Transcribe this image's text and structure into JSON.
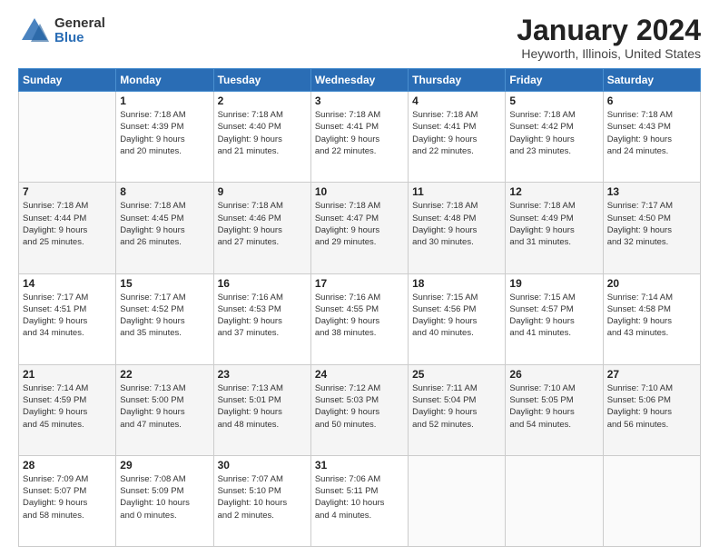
{
  "logo": {
    "general": "General",
    "blue": "Blue"
  },
  "header": {
    "title": "January 2024",
    "subtitle": "Heyworth, Illinois, United States"
  },
  "days_of_week": [
    "Sunday",
    "Monday",
    "Tuesday",
    "Wednesday",
    "Thursday",
    "Friday",
    "Saturday"
  ],
  "weeks": [
    [
      {
        "day": "",
        "info": ""
      },
      {
        "day": "1",
        "info": "Sunrise: 7:18 AM\nSunset: 4:39 PM\nDaylight: 9 hours\nand 20 minutes."
      },
      {
        "day": "2",
        "info": "Sunrise: 7:18 AM\nSunset: 4:40 PM\nDaylight: 9 hours\nand 21 minutes."
      },
      {
        "day": "3",
        "info": "Sunrise: 7:18 AM\nSunset: 4:41 PM\nDaylight: 9 hours\nand 22 minutes."
      },
      {
        "day": "4",
        "info": "Sunrise: 7:18 AM\nSunset: 4:41 PM\nDaylight: 9 hours\nand 22 minutes."
      },
      {
        "day": "5",
        "info": "Sunrise: 7:18 AM\nSunset: 4:42 PM\nDaylight: 9 hours\nand 23 minutes."
      },
      {
        "day": "6",
        "info": "Sunrise: 7:18 AM\nSunset: 4:43 PM\nDaylight: 9 hours\nand 24 minutes."
      }
    ],
    [
      {
        "day": "7",
        "info": "Sunrise: 7:18 AM\nSunset: 4:44 PM\nDaylight: 9 hours\nand 25 minutes."
      },
      {
        "day": "8",
        "info": "Sunrise: 7:18 AM\nSunset: 4:45 PM\nDaylight: 9 hours\nand 26 minutes."
      },
      {
        "day": "9",
        "info": "Sunrise: 7:18 AM\nSunset: 4:46 PM\nDaylight: 9 hours\nand 27 minutes."
      },
      {
        "day": "10",
        "info": "Sunrise: 7:18 AM\nSunset: 4:47 PM\nDaylight: 9 hours\nand 29 minutes."
      },
      {
        "day": "11",
        "info": "Sunrise: 7:18 AM\nSunset: 4:48 PM\nDaylight: 9 hours\nand 30 minutes."
      },
      {
        "day": "12",
        "info": "Sunrise: 7:18 AM\nSunset: 4:49 PM\nDaylight: 9 hours\nand 31 minutes."
      },
      {
        "day": "13",
        "info": "Sunrise: 7:17 AM\nSunset: 4:50 PM\nDaylight: 9 hours\nand 32 minutes."
      }
    ],
    [
      {
        "day": "14",
        "info": "Sunrise: 7:17 AM\nSunset: 4:51 PM\nDaylight: 9 hours\nand 34 minutes."
      },
      {
        "day": "15",
        "info": "Sunrise: 7:17 AM\nSunset: 4:52 PM\nDaylight: 9 hours\nand 35 minutes."
      },
      {
        "day": "16",
        "info": "Sunrise: 7:16 AM\nSunset: 4:53 PM\nDaylight: 9 hours\nand 37 minutes."
      },
      {
        "day": "17",
        "info": "Sunrise: 7:16 AM\nSunset: 4:55 PM\nDaylight: 9 hours\nand 38 minutes."
      },
      {
        "day": "18",
        "info": "Sunrise: 7:15 AM\nSunset: 4:56 PM\nDaylight: 9 hours\nand 40 minutes."
      },
      {
        "day": "19",
        "info": "Sunrise: 7:15 AM\nSunset: 4:57 PM\nDaylight: 9 hours\nand 41 minutes."
      },
      {
        "day": "20",
        "info": "Sunrise: 7:14 AM\nSunset: 4:58 PM\nDaylight: 9 hours\nand 43 minutes."
      }
    ],
    [
      {
        "day": "21",
        "info": "Sunrise: 7:14 AM\nSunset: 4:59 PM\nDaylight: 9 hours\nand 45 minutes."
      },
      {
        "day": "22",
        "info": "Sunrise: 7:13 AM\nSunset: 5:00 PM\nDaylight: 9 hours\nand 47 minutes."
      },
      {
        "day": "23",
        "info": "Sunrise: 7:13 AM\nSunset: 5:01 PM\nDaylight: 9 hours\nand 48 minutes."
      },
      {
        "day": "24",
        "info": "Sunrise: 7:12 AM\nSunset: 5:03 PM\nDaylight: 9 hours\nand 50 minutes."
      },
      {
        "day": "25",
        "info": "Sunrise: 7:11 AM\nSunset: 5:04 PM\nDaylight: 9 hours\nand 52 minutes."
      },
      {
        "day": "26",
        "info": "Sunrise: 7:10 AM\nSunset: 5:05 PM\nDaylight: 9 hours\nand 54 minutes."
      },
      {
        "day": "27",
        "info": "Sunrise: 7:10 AM\nSunset: 5:06 PM\nDaylight: 9 hours\nand 56 minutes."
      }
    ],
    [
      {
        "day": "28",
        "info": "Sunrise: 7:09 AM\nSunset: 5:07 PM\nDaylight: 9 hours\nand 58 minutes."
      },
      {
        "day": "29",
        "info": "Sunrise: 7:08 AM\nSunset: 5:09 PM\nDaylight: 10 hours\nand 0 minutes."
      },
      {
        "day": "30",
        "info": "Sunrise: 7:07 AM\nSunset: 5:10 PM\nDaylight: 10 hours\nand 2 minutes."
      },
      {
        "day": "31",
        "info": "Sunrise: 7:06 AM\nSunset: 5:11 PM\nDaylight: 10 hours\nand 4 minutes."
      },
      {
        "day": "",
        "info": ""
      },
      {
        "day": "",
        "info": ""
      },
      {
        "day": "",
        "info": ""
      }
    ]
  ]
}
